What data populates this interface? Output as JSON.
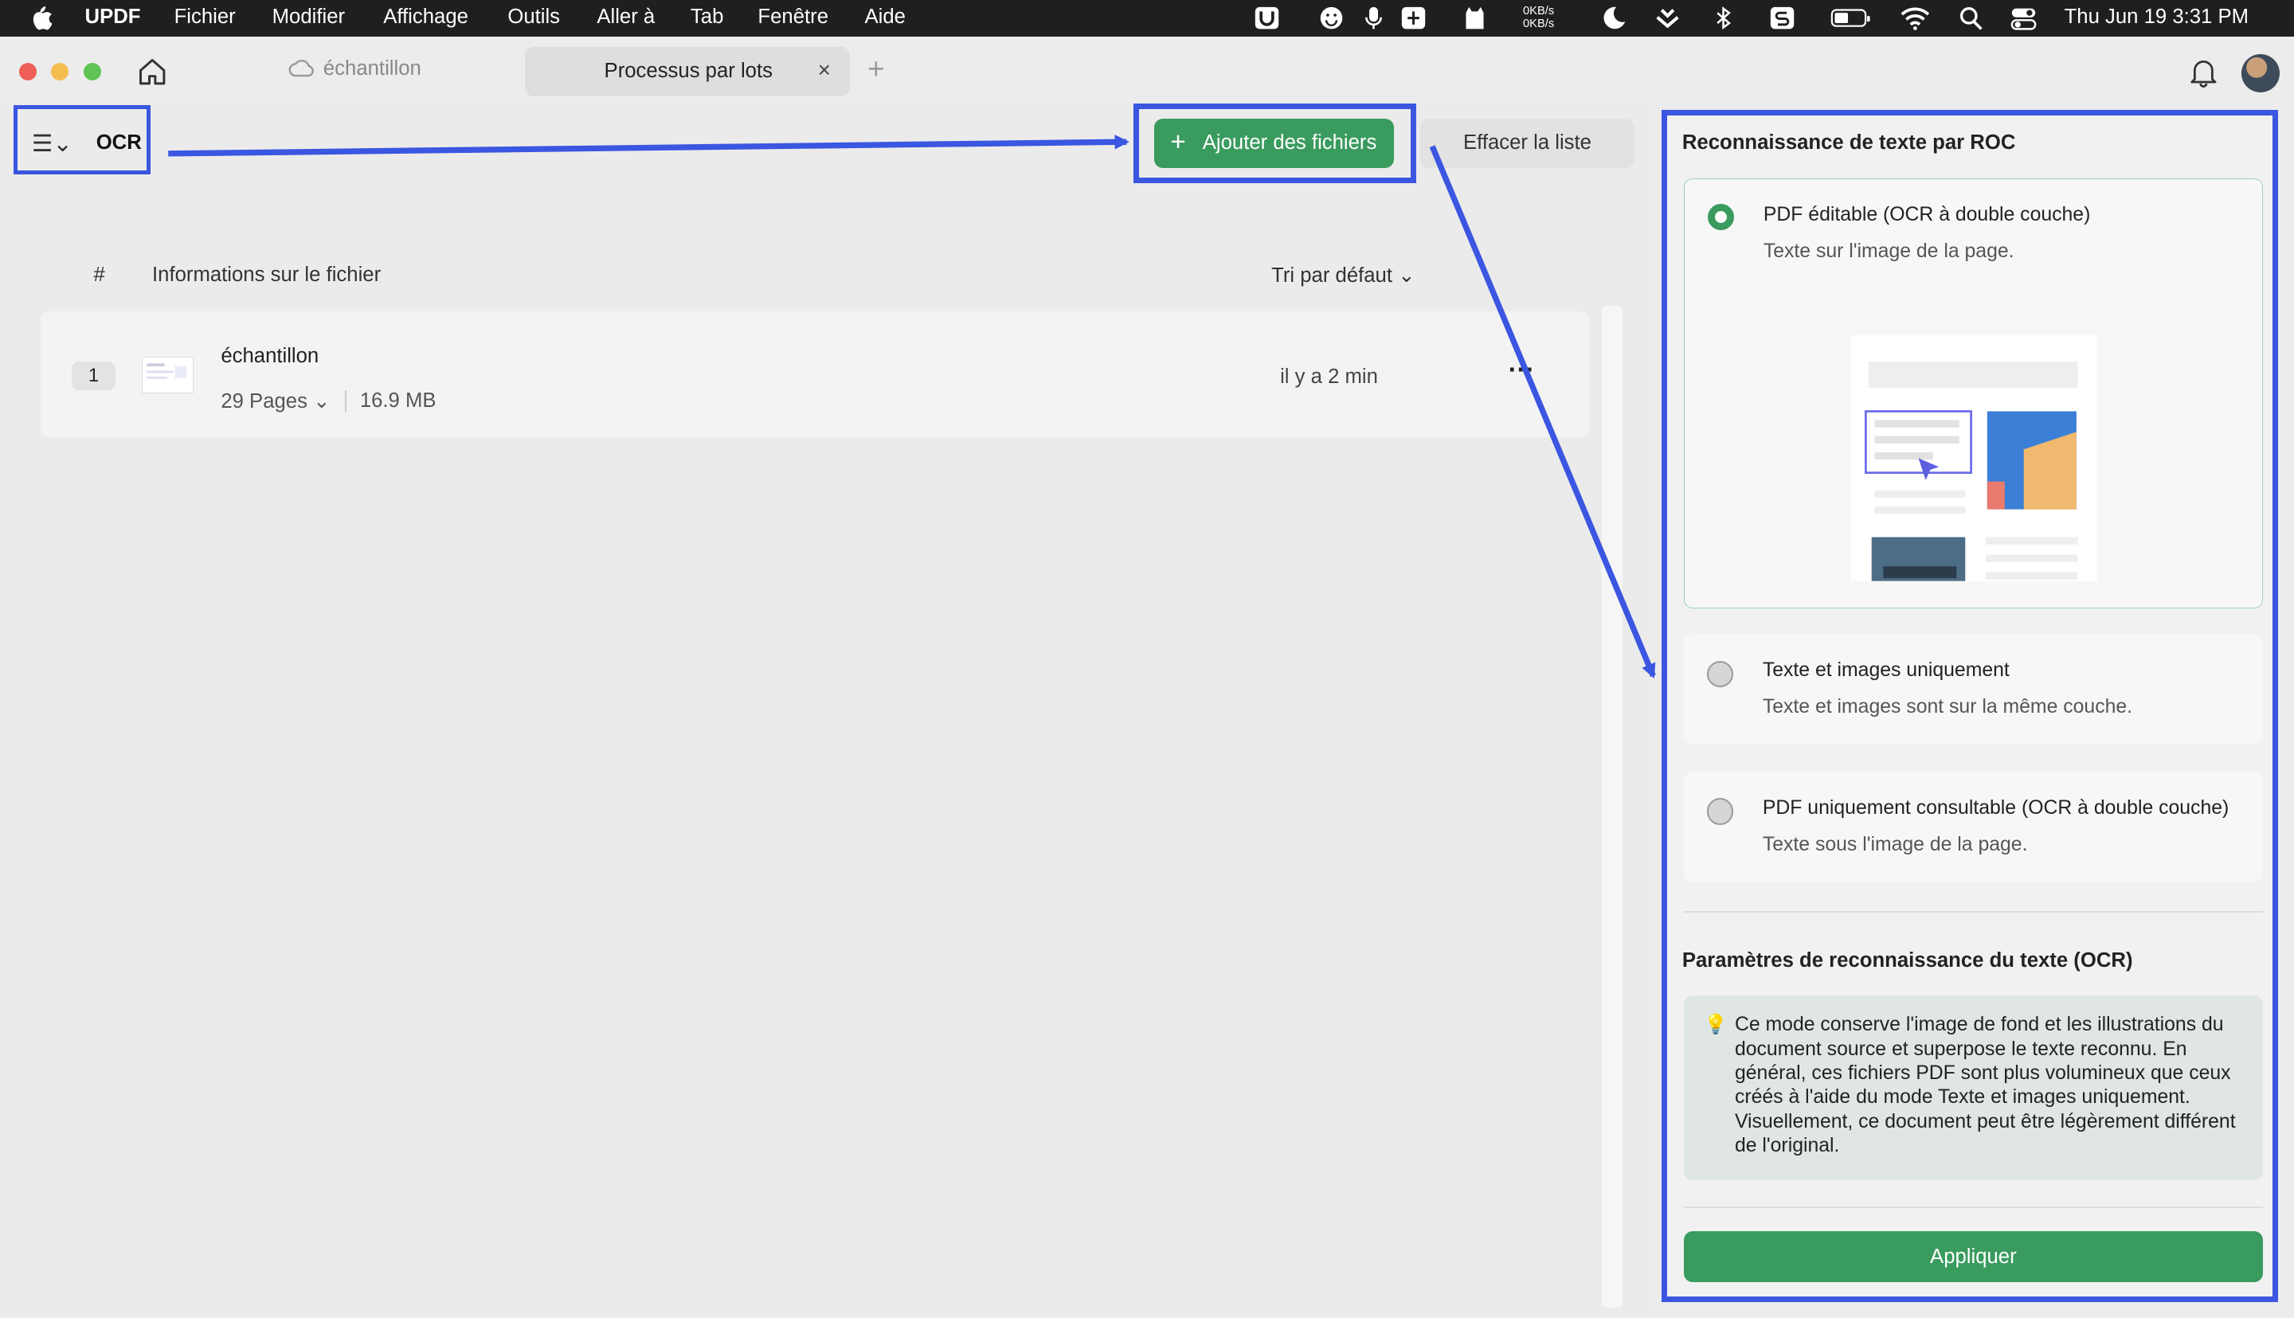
{
  "menubar": {
    "app": "UPDF",
    "items": [
      "Fichier",
      "Modifier",
      "Affichage",
      "Outils",
      "Aller à",
      "Tab",
      "Fenêtre",
      "Aide"
    ],
    "net_up": "0KB/s",
    "net_down": "0KB/s",
    "clock": "Thu Jun 19  3:31 PM"
  },
  "tabs": {
    "first": "échantillon",
    "active": "Processus par lots",
    "close": "×",
    "new": "+"
  },
  "toolbar": {
    "mode_label": "OCR",
    "add_files": "Ajouter des fichiers",
    "add_plus": "+",
    "clear_list": "Effacer la liste"
  },
  "file_list": {
    "header_number": "#",
    "header_info": "Informations sur le fichier",
    "sort": "Tri par défaut",
    "rows": [
      {
        "index": "1",
        "name": "échantillon",
        "pages": "29 Pages",
        "size": "16.9 MB",
        "time": "il y a 2 min",
        "more": "···"
      }
    ]
  },
  "panel": {
    "title": "Reconnaissance de texte par ROC",
    "options": [
      {
        "title": "PDF éditable (OCR à double couche)",
        "desc": "Texte sur l'image de la page.",
        "selected": true
      },
      {
        "title": "Texte et images uniquement",
        "desc": "Texte et images sont sur la même couche.",
        "selected": false
      },
      {
        "title": "PDF uniquement consultable (OCR à double couche)",
        "desc": "Texte sous l'image de la page.",
        "selected": false
      }
    ],
    "params_title": "Paramètres de reconnaissance du texte (OCR)",
    "note": "Ce mode conserve l'image de fond et les illustrations du document source et superpose le texte reconnu. En général, ces fichiers PDF sont plus volumineux que ceux créés à l'aide du mode Texte et images uniquement. Visuellement, ce document peut être légèrement différent de l'original.",
    "apply": "Appliquer"
  },
  "colors": {
    "accent_green": "#3a9b5f",
    "annotation_blue": "#3b56e0"
  }
}
